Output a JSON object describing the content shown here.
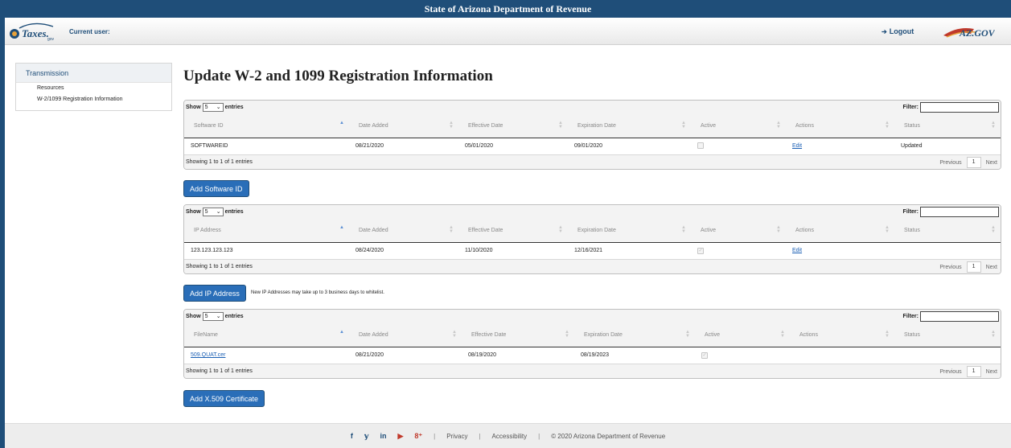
{
  "app": {
    "title": "State of Arizona Department of Revenue"
  },
  "header": {
    "current_user_label": "Current user:",
    "logout_label": "Logout",
    "logo_left_text": "Taxes",
    "logo_right_text": "AZ.GOV"
  },
  "sidebar": {
    "heading": "Transmission",
    "items": [
      {
        "label": "Resources"
      },
      {
        "label": "W-2/1099 Registration Information"
      }
    ]
  },
  "page": {
    "title": "Update W-2 and 1099 Registration Information"
  },
  "common": {
    "show_label": "Show",
    "entries_label": "entries",
    "page_size": "5",
    "filter_label": "Filter:",
    "previous_label": "Previous",
    "next_label": "Next",
    "page_number": "1",
    "showing_text": "Showing 1 to 1 of 1 entries"
  },
  "software_table": {
    "columns": [
      "Software ID",
      "Date Added",
      "Effective Date",
      "Expiration Date",
      "Active",
      "Actions",
      "Status"
    ],
    "rows": [
      {
        "id": "SOFTWAREID",
        "date_added": "08/21/2020",
        "effective": "05/01/2020",
        "expiration": "09/01/2020",
        "active": false,
        "action": "Edit",
        "status": "Updated"
      }
    ],
    "add_button": "Add Software ID"
  },
  "ip_table": {
    "columns": [
      "IP Address",
      "Date Added",
      "Effective Date",
      "Expiration Date",
      "Active",
      "Actions",
      "Status"
    ],
    "rows": [
      {
        "ip": "123.123.123.123",
        "date_added": "08/24/2020",
        "effective": "11/10/2020",
        "expiration": "12/16/2021",
        "active": true,
        "action": "Edit",
        "status": ""
      }
    ],
    "add_button": "Add IP Address",
    "note": "New IP Addresses may take up to 3 business days to whitelist."
  },
  "cert_table": {
    "columns": [
      "FileName",
      "Date Added",
      "Effective Date",
      "Expiration Date",
      "Active",
      "Actions",
      "Status"
    ],
    "rows": [
      {
        "file": "509.QUAT.cer",
        "date_added": "08/21/2020",
        "effective": "08/19/2020",
        "expiration": "08/19/2023",
        "active": true,
        "action": "",
        "status": ""
      }
    ],
    "add_button": "Add X.509 Certificate"
  },
  "footer": {
    "social": [
      "f",
      "y",
      "in",
      "yt",
      "g+"
    ],
    "privacy": "Privacy",
    "accessibility": "Accessibility",
    "copyright": "© 2020 Arizona Department of Revenue",
    "separator": "|"
  },
  "colors": {
    "brand": "#1f4e79",
    "button": "#2a6eb8",
    "link": "#1a5fb4"
  }
}
